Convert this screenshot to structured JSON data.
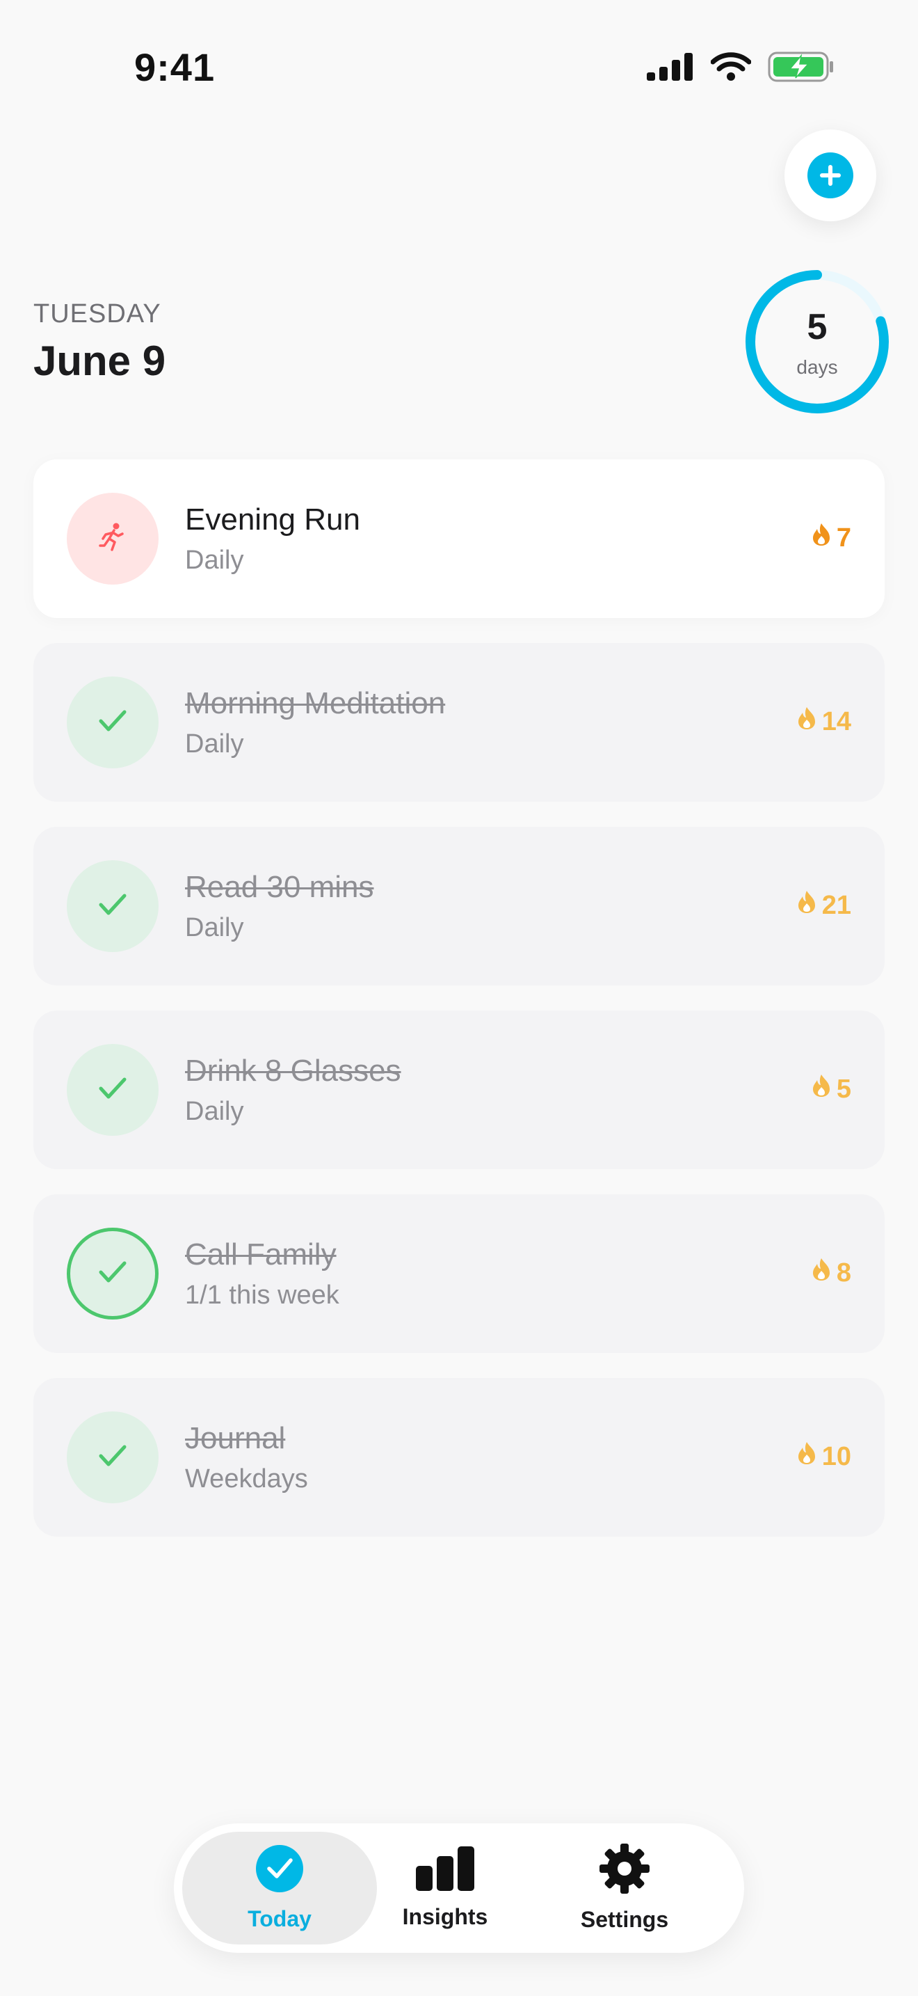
{
  "status_bar": {
    "time": "9:41"
  },
  "header": {
    "weekday": "TUESDAY",
    "date": "June 9"
  },
  "streak": {
    "value": "5",
    "unit": "days",
    "progress": 0.8
  },
  "colors": {
    "accent": "#00b8e6",
    "success": "#4cc76d",
    "flame": "#f5a623",
    "run": "#ff5a5f"
  },
  "habits": [
    {
      "title": "Evening Run",
      "frequency": "Daily",
      "streak": "7",
      "done": false,
      "icon": "running-icon"
    },
    {
      "title": "Morning Meditation",
      "frequency": "Daily",
      "streak": "14",
      "done": true,
      "icon": "checkmark-icon"
    },
    {
      "title": "Read 30 mins",
      "frequency": "Daily",
      "streak": "21",
      "done": true,
      "icon": "checkmark-icon"
    },
    {
      "title": "Drink 8 Glasses",
      "frequency": "Daily",
      "streak": "5",
      "done": true,
      "icon": "checkmark-icon"
    },
    {
      "title": "Call Family",
      "frequency": "1/1 this week",
      "streak": "8",
      "done": true,
      "icon": "checkmark-icon"
    },
    {
      "title": "Journal",
      "frequency": "Weekdays",
      "streak": "10",
      "done": true,
      "icon": "checkmark-icon"
    }
  ],
  "tabs": [
    {
      "label": "Today",
      "icon": "checkmark-circle-icon",
      "selected": true
    },
    {
      "label": "Insights",
      "icon": "bar-chart-icon",
      "selected": false
    },
    {
      "label": "Settings",
      "icon": "gear-icon",
      "selected": false
    }
  ]
}
